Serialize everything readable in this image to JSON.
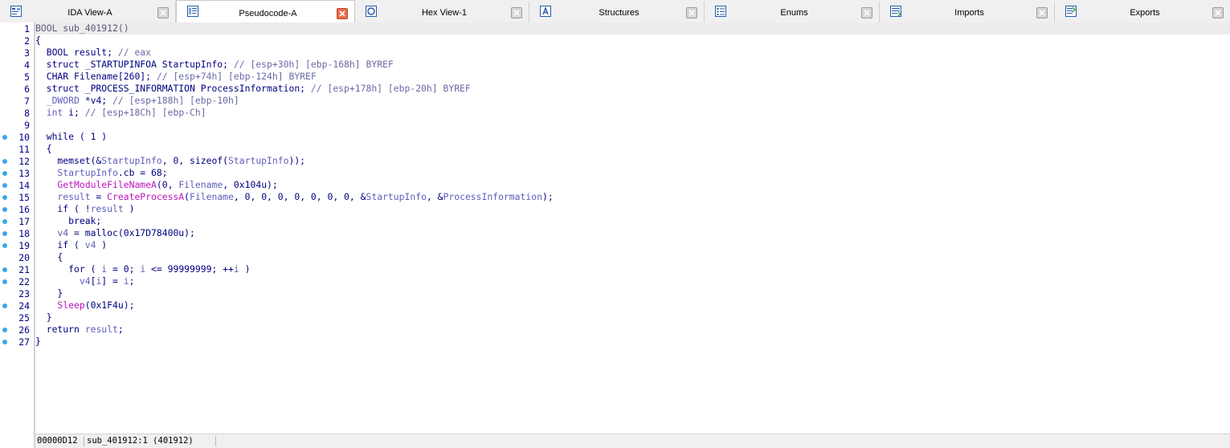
{
  "tabs": [
    {
      "label": "IDA View-A",
      "icon": "ida-view-icon",
      "active": false
    },
    {
      "label": "Pseudocode-A",
      "icon": "pseudocode-icon",
      "active": true
    },
    {
      "label": "Hex View-1",
      "icon": "hex-view-icon",
      "active": false
    },
    {
      "label": "Structures",
      "icon": "structures-icon",
      "active": false
    },
    {
      "label": "Enums",
      "icon": "enums-icon",
      "active": false
    },
    {
      "label": "Imports",
      "icon": "imports-icon",
      "active": false
    },
    {
      "label": "Exports",
      "icon": "exports-icon",
      "active": false
    }
  ],
  "colors": {
    "keyword": "#000080",
    "comment": "#6a6aa8",
    "variable": "#5e5ebc",
    "function": "#c012c0",
    "breakpoint": "#3ea6e6",
    "active_close": "#e86c4a"
  },
  "code_lines": [
    {
      "num": "1",
      "bp": false,
      "segs": [
        [
          "gray",
          "BOOL sub_401912()"
        ]
      ]
    },
    {
      "num": "2",
      "bp": false,
      "segs": [
        [
          "pl",
          "{"
        ]
      ]
    },
    {
      "num": "3",
      "bp": false,
      "segs": [
        [
          "pl",
          "  BOOL result; "
        ],
        [
          "cm",
          "// eax"
        ]
      ]
    },
    {
      "num": "4",
      "bp": false,
      "segs": [
        [
          "pl",
          "  struct _STARTUPINFOA StartupInfo; "
        ],
        [
          "cm",
          "// [esp+30h] [ebp-168h] BYREF"
        ]
      ]
    },
    {
      "num": "5",
      "bp": false,
      "segs": [
        [
          "pl",
          "  CHAR Filename[260]; "
        ],
        [
          "cm",
          "// [esp+74h] [ebp-124h] BYREF"
        ]
      ]
    },
    {
      "num": "6",
      "bp": false,
      "segs": [
        [
          "pl",
          "  struct _PROCESS_INFORMATION ProcessInformation; "
        ],
        [
          "cm",
          "// [esp+178h] [ebp-20h] BYREF"
        ]
      ]
    },
    {
      "num": "7",
      "bp": false,
      "segs": [
        [
          "vr",
          "  _DWORD "
        ],
        [
          "pl",
          "*v4; "
        ],
        [
          "cm",
          "// [esp+188h] [ebp-10h]"
        ]
      ]
    },
    {
      "num": "8",
      "bp": false,
      "segs": [
        [
          "vr",
          "  int "
        ],
        [
          "pl",
          "i; "
        ],
        [
          "cm",
          "// [esp+18Ch] [ebp-Ch]"
        ]
      ]
    },
    {
      "num": "9",
      "bp": false,
      "segs": [
        [
          "pl",
          ""
        ]
      ]
    },
    {
      "num": "10",
      "bp": true,
      "segs": [
        [
          "pl",
          "  while ( 1 )"
        ]
      ]
    },
    {
      "num": "11",
      "bp": false,
      "segs": [
        [
          "pl",
          "  {"
        ]
      ]
    },
    {
      "num": "12",
      "bp": true,
      "segs": [
        [
          "pl",
          "    memset(&"
        ],
        [
          "vr",
          "StartupInfo"
        ],
        [
          "pl",
          ", 0, sizeof("
        ],
        [
          "vr",
          "StartupInfo"
        ],
        [
          "pl",
          "));"
        ]
      ]
    },
    {
      "num": "13",
      "bp": true,
      "segs": [
        [
          "vr",
          "    StartupInfo"
        ],
        [
          "pl",
          ".cb = 68;"
        ]
      ]
    },
    {
      "num": "14",
      "bp": true,
      "segs": [
        [
          "fn",
          "    GetModuleFileNameA"
        ],
        [
          "pl",
          "(0, "
        ],
        [
          "vr",
          "Filename"
        ],
        [
          "pl",
          ", 0x104u);"
        ]
      ]
    },
    {
      "num": "15",
      "bp": true,
      "segs": [
        [
          "vr",
          "    result"
        ],
        [
          "pl",
          " = "
        ],
        [
          "fn",
          "CreateProcessA"
        ],
        [
          "pl",
          "("
        ],
        [
          "vr",
          "Filename"
        ],
        [
          "pl",
          ", 0, 0, 0, 0, 0, 0, 0, &"
        ],
        [
          "vr",
          "StartupInfo"
        ],
        [
          "pl",
          ", &"
        ],
        [
          "vr",
          "ProcessInformation"
        ],
        [
          "pl",
          ");"
        ]
      ]
    },
    {
      "num": "16",
      "bp": true,
      "segs": [
        [
          "pl",
          "    if ( !"
        ],
        [
          "vr",
          "result"
        ],
        [
          "pl",
          " )"
        ]
      ]
    },
    {
      "num": "17",
      "bp": true,
      "segs": [
        [
          "pl",
          "      break;"
        ]
      ]
    },
    {
      "num": "18",
      "bp": true,
      "segs": [
        [
          "vr",
          "    v4"
        ],
        [
          "pl",
          " = malloc(0x17D78400u);"
        ]
      ]
    },
    {
      "num": "19",
      "bp": true,
      "segs": [
        [
          "pl",
          "    if ( "
        ],
        [
          "vr",
          "v4"
        ],
        [
          "pl",
          " )"
        ]
      ]
    },
    {
      "num": "20",
      "bp": false,
      "segs": [
        [
          "pl",
          "    {"
        ]
      ]
    },
    {
      "num": "21",
      "bp": true,
      "segs": [
        [
          "pl",
          "      for ( "
        ],
        [
          "vr",
          "i"
        ],
        [
          "pl",
          " = 0; "
        ],
        [
          "vr",
          "i"
        ],
        [
          "pl",
          " <= 99999999; ++"
        ],
        [
          "vr",
          "i"
        ],
        [
          "pl",
          " )"
        ]
      ]
    },
    {
      "num": "22",
      "bp": true,
      "segs": [
        [
          "vr",
          "        v4"
        ],
        [
          "pl",
          "["
        ],
        [
          "vr",
          "i"
        ],
        [
          "pl",
          "] = "
        ],
        [
          "vr",
          "i"
        ],
        [
          "pl",
          ";"
        ]
      ]
    },
    {
      "num": "23",
      "bp": false,
      "segs": [
        [
          "pl",
          "    }"
        ]
      ]
    },
    {
      "num": "24",
      "bp": true,
      "segs": [
        [
          "fn",
          "    Sleep"
        ],
        [
          "pl",
          "(0x1F4u);"
        ]
      ]
    },
    {
      "num": "25",
      "bp": false,
      "segs": [
        [
          "pl",
          "  }"
        ]
      ]
    },
    {
      "num": "26",
      "bp": true,
      "segs": [
        [
          "pl",
          "  return "
        ],
        [
          "vr",
          "result"
        ],
        [
          "pl",
          ";"
        ]
      ]
    },
    {
      "num": "27",
      "bp": true,
      "segs": [
        [
          "pl",
          "}"
        ]
      ]
    }
  ],
  "status": {
    "address": "00000D12",
    "location": "sub_401912:1 (401912)"
  }
}
